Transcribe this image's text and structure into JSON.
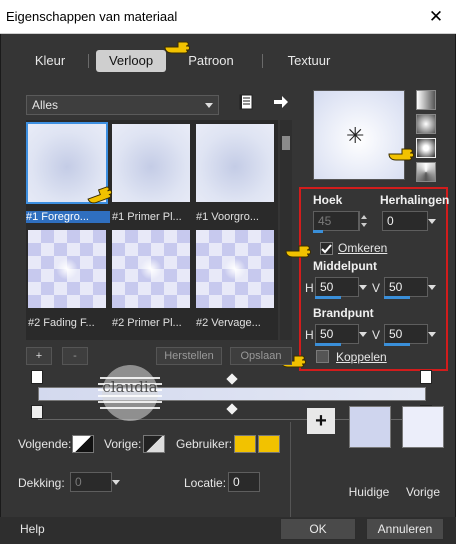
{
  "window": {
    "title": "Eigenschappen van materiaal",
    "close_glyph": "✕"
  },
  "tabs": [
    {
      "label": "Kleur",
      "active": false
    },
    {
      "label": "Verloop",
      "active": true
    },
    {
      "label": "Patroon",
      "active": false
    },
    {
      "label": "Textuur",
      "active": false
    }
  ],
  "category": {
    "value": "Alles"
  },
  "gradients": [
    {
      "caption": "#1 Foregro...",
      "style": "radial",
      "selected": true
    },
    {
      "caption": "#1 Primer Pl...",
      "style": "radial",
      "selected": false
    },
    {
      "caption": "#1 Voorgro...",
      "style": "radial",
      "selected": false
    },
    {
      "caption": "#2 Fading F...",
      "style": "checker",
      "selected": false
    },
    {
      "caption": "#2 Primer Pl...",
      "style": "checker",
      "selected": false
    },
    {
      "caption": "#2 Vervage...",
      "style": "checker",
      "selected": false
    }
  ],
  "library_buttons": {
    "add": "+",
    "remove": "-",
    "reset": "Herstellen",
    "save": "Opslaan"
  },
  "properties": {
    "angle_label": "Hoek",
    "angle_value": "45",
    "repeats_label": "Herhalingen",
    "repeats_value": "0",
    "invert_label": "Omkeren",
    "invert_checked": true,
    "center_label": "Middelpunt",
    "center_h_label": "H",
    "center_h_value": "50",
    "center_v_label": "V",
    "center_v_value": "50",
    "focal_label": "Brandpunt",
    "focal_h_label": "H",
    "focal_h_value": "50",
    "focal_v_label": "V",
    "focal_v_value": "50",
    "link_label": "Koppelen",
    "link_checked": false
  },
  "stop_controls": {
    "follow_label": "Volgende:",
    "previous_label": "Vorige:",
    "user_label": "Gebruiker:",
    "user_color_1": "#f2c200",
    "user_color_2": "#f2c200",
    "opacity_label": "Dekking:",
    "opacity_value": "0",
    "location_label": "Locatie:",
    "location_value": "0"
  },
  "swatches": {
    "current_label": "Huidige",
    "current_color": "#cfd5ee",
    "previous_label": "Vorige",
    "previous_color": "#eceefa",
    "add_glyph": "+"
  },
  "footer": {
    "help": "Help",
    "ok": "OK",
    "cancel": "Annuleren"
  },
  "watermark": {
    "text": "claudia"
  },
  "colors": {
    "accent": "#3d8fe0",
    "highlight_box": "#d21c1c",
    "pointer": "#f2c200"
  }
}
